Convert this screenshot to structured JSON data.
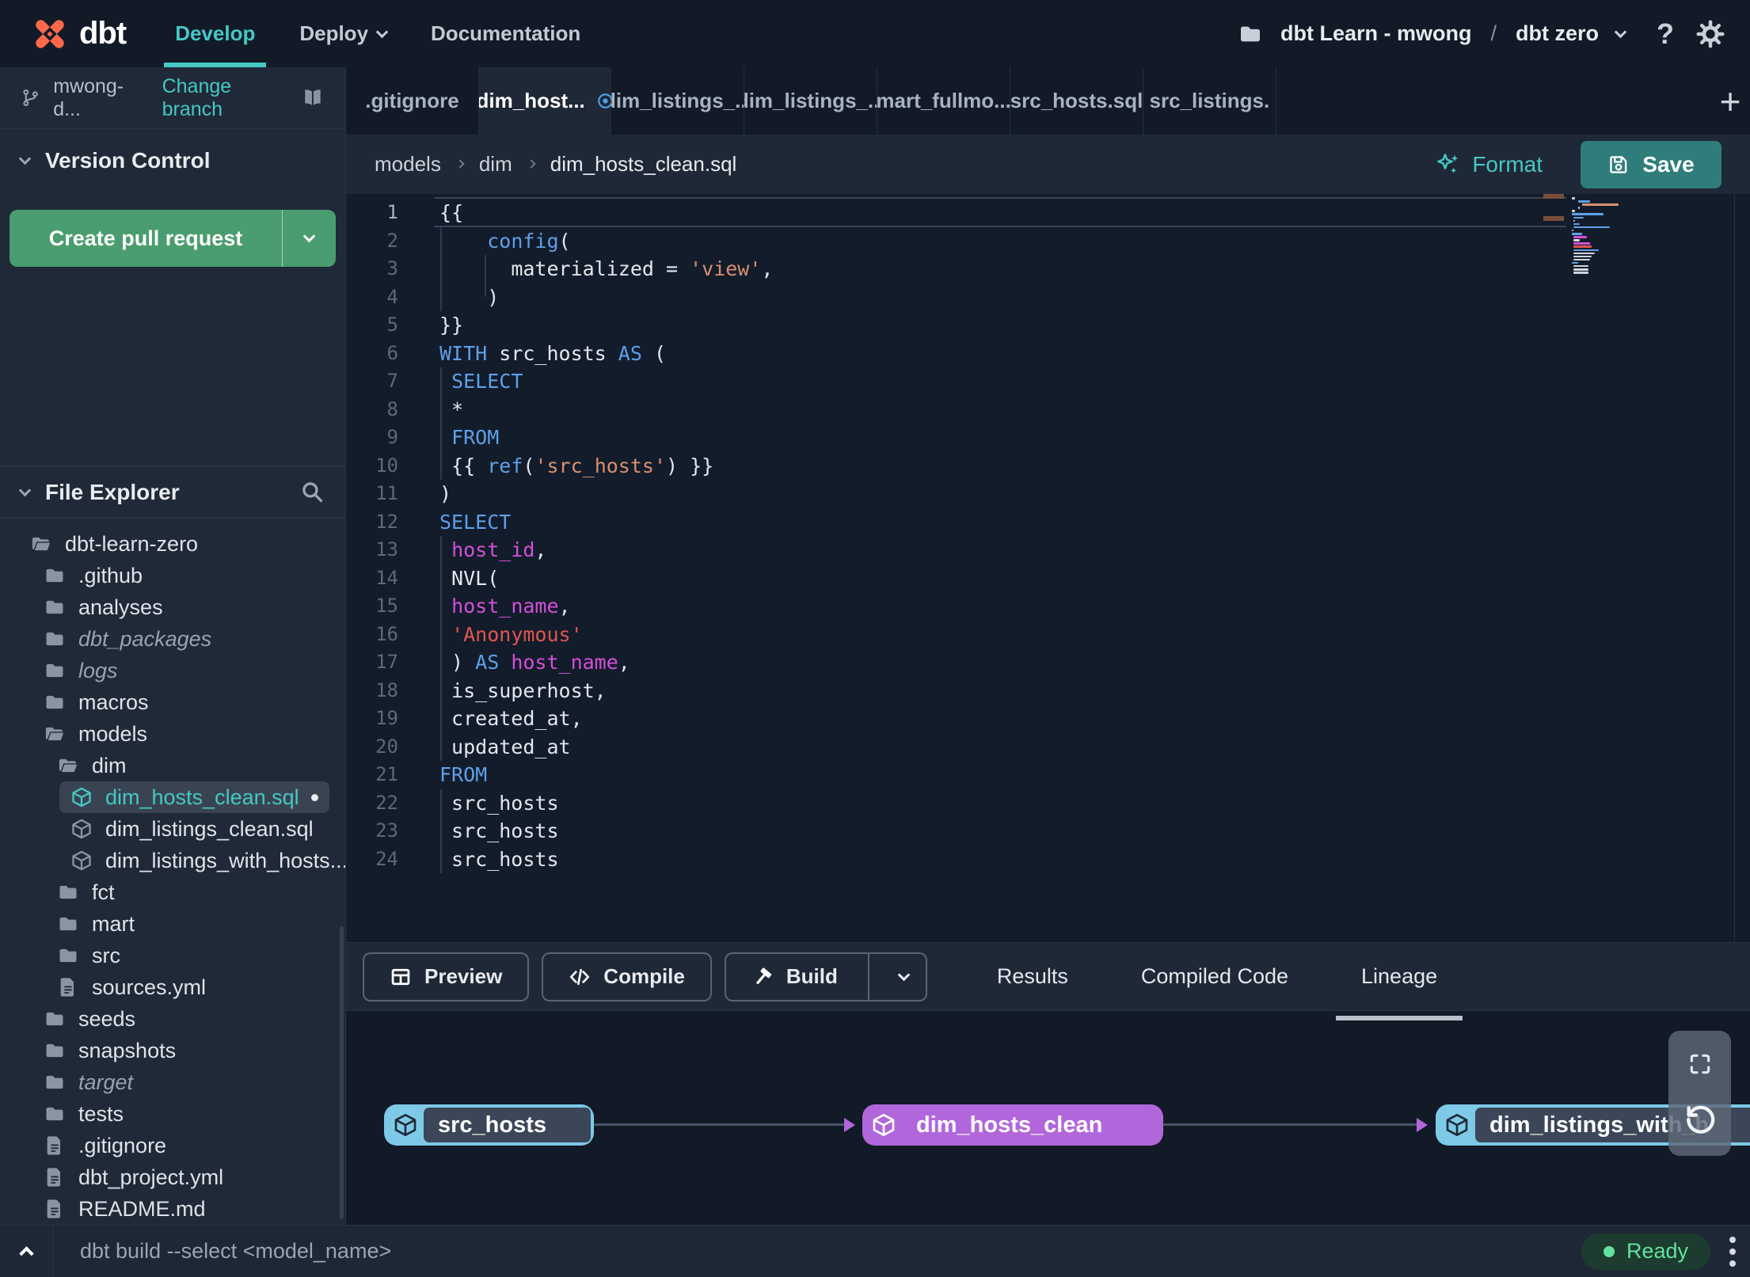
{
  "colors": {
    "brand_orange": "#ff694a",
    "accent_teal": "#45c8c4",
    "save_teal": "#2e7d7b",
    "button_green": "#4a9d6e",
    "node_blue": "#7ec9e8",
    "node_purple": "#b266db",
    "status_green": "#63e29e",
    "dirty_blue": "#4aa3e8",
    "code_keyword": "#5ea0e8",
    "code_string": "#d8906f",
    "code_string_alt": "#e25550",
    "code_identifier": "#d44fd9",
    "code_plain": "#e3e7ec"
  },
  "navbar": {
    "logo_text": "dbt",
    "items": [
      {
        "label": "Develop",
        "active": true
      },
      {
        "label": "Deploy",
        "has_menu": true
      },
      {
        "label": "Documentation"
      }
    ],
    "account": "dbt Learn - mwong",
    "separator": "/",
    "project": "dbt zero",
    "help_label": "?"
  },
  "sidebar": {
    "branch": {
      "name": "mwong-d...",
      "change_link": "Change branch"
    },
    "version_control": {
      "title": "Version Control",
      "create_pr_label": "Create pull request"
    },
    "file_explorer": {
      "title": "File Explorer",
      "tree": [
        {
          "label": "dbt-learn-zero",
          "depth": 0,
          "icon": "folder-open"
        },
        {
          "label": ".github",
          "depth": 1,
          "icon": "folder"
        },
        {
          "label": "analyses",
          "depth": 1,
          "icon": "folder"
        },
        {
          "label": "dbt_packages",
          "depth": 1,
          "icon": "folder",
          "muted": true
        },
        {
          "label": "logs",
          "depth": 1,
          "icon": "folder",
          "muted": true
        },
        {
          "label": "macros",
          "depth": 1,
          "icon": "folder"
        },
        {
          "label": "models",
          "depth": 1,
          "icon": "folder-open"
        },
        {
          "label": "dim",
          "depth": 2,
          "icon": "folder-open"
        },
        {
          "label": "dim_hosts_clean.sql",
          "depth": 3,
          "icon": "model",
          "selected": true
        },
        {
          "label": "dim_listings_clean.sql",
          "depth": 3,
          "icon": "model"
        },
        {
          "label": "dim_listings_with_hosts...",
          "depth": 3,
          "icon": "model"
        },
        {
          "label": "fct",
          "depth": 2,
          "icon": "folder"
        },
        {
          "label": "mart",
          "depth": 2,
          "icon": "folder"
        },
        {
          "label": "src",
          "depth": 2,
          "icon": "folder"
        },
        {
          "label": "sources.yml",
          "depth": 2,
          "icon": "file"
        },
        {
          "label": "seeds",
          "depth": 1,
          "icon": "folder"
        },
        {
          "label": "snapshots",
          "depth": 1,
          "icon": "folder"
        },
        {
          "label": "target",
          "depth": 1,
          "icon": "folder",
          "muted": true
        },
        {
          "label": "tests",
          "depth": 1,
          "icon": "folder"
        },
        {
          "label": ".gitignore",
          "depth": 1,
          "icon": "file"
        },
        {
          "label": "dbt_project.yml",
          "depth": 1,
          "icon": "file"
        },
        {
          "label": "README.md",
          "depth": 1,
          "icon": "file"
        }
      ]
    }
  },
  "tabs": {
    "items": [
      {
        "label": ".gitignore"
      },
      {
        "label": "dim_host...",
        "active": true,
        "dirty": true
      },
      {
        "label": "dim_listings_..."
      },
      {
        "label": "dim_listings_..."
      },
      {
        "label": "mart_fullmo..."
      },
      {
        "label": "src_hosts.sql"
      },
      {
        "label": "src_listings."
      }
    ],
    "add_label": "+"
  },
  "breadcrumb": {
    "path": [
      "models",
      "dim",
      "dim_hosts_clean.sql"
    ],
    "format_label": "Format",
    "save_label": "Save"
  },
  "editor": {
    "active_line": 1,
    "lines": [
      {
        "n": 1,
        "tokens": [
          [
            "{{",
            "pln"
          ]
        ]
      },
      {
        "n": 2,
        "tokens": [
          [
            "    ",
            "pln"
          ],
          [
            "config",
            "kw"
          ],
          [
            "(",
            "pln"
          ]
        ]
      },
      {
        "n": 3,
        "tokens": [
          [
            "      ",
            "pln"
          ],
          [
            "materialized = ",
            "pln"
          ],
          [
            "'view'",
            "str"
          ],
          [
            ",",
            "pln"
          ]
        ]
      },
      {
        "n": 4,
        "tokens": [
          [
            "    )",
            "pln"
          ]
        ]
      },
      {
        "n": 5,
        "tokens": [
          [
            "}}",
            "pln"
          ]
        ]
      },
      {
        "n": 6,
        "tokens": [
          [
            "WITH",
            "kw"
          ],
          [
            " src_hosts ",
            "pln"
          ],
          [
            "AS",
            "kw"
          ],
          [
            " (",
            "pln"
          ]
        ]
      },
      {
        "n": 7,
        "tokens": [
          [
            " ",
            "pln"
          ],
          [
            "SELECT",
            "kw"
          ]
        ]
      },
      {
        "n": 8,
        "tokens": [
          [
            " *",
            "pln"
          ]
        ]
      },
      {
        "n": 9,
        "tokens": [
          [
            " ",
            "pln"
          ],
          [
            "FROM",
            "kw"
          ]
        ]
      },
      {
        "n": 10,
        "tokens": [
          [
            " {{ ",
            "pln"
          ],
          [
            "ref",
            "kw"
          ],
          [
            "(",
            "pln"
          ],
          [
            "'src_hosts'",
            "str"
          ],
          [
            ") }}",
            "pln"
          ]
        ]
      },
      {
        "n": 11,
        "tokens": [
          [
            ")",
            "pln"
          ]
        ]
      },
      {
        "n": 12,
        "tokens": [
          [
            "SELECT",
            "kw"
          ]
        ]
      },
      {
        "n": 13,
        "tokens": [
          [
            " ",
            "pln"
          ],
          [
            "host_id",
            "id"
          ],
          [
            ",",
            "pln"
          ]
        ]
      },
      {
        "n": 14,
        "tokens": [
          [
            " NVL(",
            "pln"
          ]
        ]
      },
      {
        "n": 15,
        "tokens": [
          [
            " ",
            "pln"
          ],
          [
            "host_name",
            "id"
          ],
          [
            ",",
            "pln"
          ]
        ]
      },
      {
        "n": 16,
        "tokens": [
          [
            " ",
            "pln"
          ],
          [
            "'Anonymous'",
            "strr"
          ]
        ]
      },
      {
        "n": 17,
        "tokens": [
          [
            " ) ",
            "pln"
          ],
          [
            "AS",
            "kw"
          ],
          [
            " ",
            "pln"
          ],
          [
            "host_name",
            "id"
          ],
          [
            ",",
            "pln"
          ]
        ]
      },
      {
        "n": 18,
        "tokens": [
          [
            " is_superhost,",
            "pln"
          ]
        ]
      },
      {
        "n": 19,
        "tokens": [
          [
            " created_at,",
            "pln"
          ]
        ]
      },
      {
        "n": 20,
        "tokens": [
          [
            " updated_at",
            "pln"
          ]
        ]
      },
      {
        "n": 21,
        "tokens": [
          [
            "FROM",
            "kw"
          ]
        ]
      },
      {
        "n": 22,
        "tokens": [
          [
            " src_hosts",
            "pln"
          ]
        ]
      },
      {
        "n": 23,
        "tokens": [
          [
            " src_hosts",
            "pln"
          ]
        ]
      },
      {
        "n": 24,
        "tokens": [
          [
            " src_hosts",
            "pln"
          ]
        ]
      }
    ]
  },
  "bottom_panel": {
    "preview_label": "Preview",
    "compile_label": "Compile",
    "build_label": "Build",
    "tabs": [
      {
        "label": "Results"
      },
      {
        "label": "Compiled Code"
      },
      {
        "label": "Lineage",
        "active": true
      }
    ],
    "lineage": {
      "nodes": [
        "src_hosts",
        "dim_hosts_clean",
        "dim_listings_with_h"
      ]
    }
  },
  "command_bar": {
    "placeholder": "dbt build --select <model_name>",
    "status": "Ready"
  }
}
